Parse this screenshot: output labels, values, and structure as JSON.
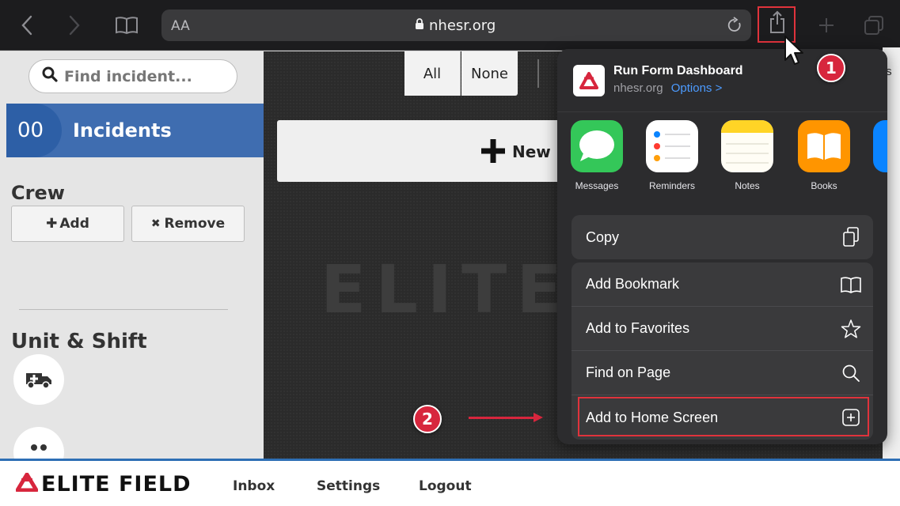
{
  "browser": {
    "text_size_label": "AA",
    "url": "nhesr.org"
  },
  "sidebar": {
    "search_placeholder": "Find incident...",
    "incidents_count": "00",
    "incidents_label": "Incidents",
    "crew_heading": "Crew",
    "add_label": "Add",
    "remove_label": "Remove",
    "unit_shift_heading": "Unit & Shift"
  },
  "main": {
    "filter_all": "All",
    "filter_none": "None",
    "new_incident_label": "New I",
    "watermark": "ELITE",
    "right_edge_text": "/s"
  },
  "share_sheet": {
    "title": "Run Form Dashboard",
    "domain": "nhesr.org",
    "options_label": "Options >",
    "apps": [
      {
        "name": "Messages",
        "icon": "messages-icon",
        "color": "#34c759"
      },
      {
        "name": "Reminders",
        "icon": "reminders-icon",
        "color": "#ffffff"
      },
      {
        "name": "Notes",
        "icon": "notes-icon",
        "color": "#ffd426"
      },
      {
        "name": "Books",
        "icon": "books-icon",
        "color": "#ff9500"
      }
    ],
    "actions": [
      {
        "label": "Copy",
        "icon": "copy-icon"
      },
      {
        "label": "Add Bookmark",
        "icon": "book-icon"
      },
      {
        "label": "Add to Favorites",
        "icon": "star-icon"
      },
      {
        "label": "Find on Page",
        "icon": "search-icon"
      },
      {
        "label": "Add to Home Screen",
        "icon": "plus-square-icon"
      }
    ]
  },
  "callouts": {
    "step1": "1",
    "step2": "2"
  },
  "bottom_bar": {
    "logo_text": "ELITE FIELD",
    "nav": [
      "Inbox",
      "Settings",
      "Logout"
    ]
  },
  "colors": {
    "accent_blue": "#3f6db0",
    "callout_red": "#d7263d",
    "share_sheet_bg": "#2c2c2e",
    "link_blue": "#4c9bff"
  }
}
